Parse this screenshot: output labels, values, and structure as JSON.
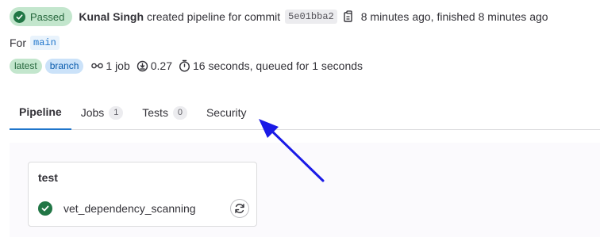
{
  "header": {
    "status_label": "Passed",
    "author": "Kunal Singh",
    "action_text": "created pipeline for commit",
    "commit_sha": "5e01bba2",
    "timing_text": "8 minutes ago, finished 8 minutes ago"
  },
  "ref": {
    "prefix": "For",
    "branch": "main"
  },
  "meta": {
    "badges": [
      "latest",
      "branch"
    ],
    "jobs": "1 job",
    "coverage": "0.27",
    "duration": "16 seconds, queued for 1 seconds"
  },
  "tabs": [
    {
      "label": "Pipeline",
      "count": null
    },
    {
      "label": "Jobs",
      "count": "1"
    },
    {
      "label": "Tests",
      "count": "0"
    },
    {
      "label": "Security",
      "count": null
    }
  ],
  "stage": {
    "title": "test",
    "job": "vet_dependency_scanning"
  },
  "colors": {
    "success": "#217645",
    "accent": "#1f75cb",
    "annotation_arrow": "#1a1ae6"
  }
}
